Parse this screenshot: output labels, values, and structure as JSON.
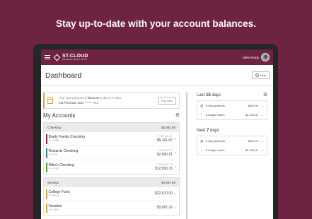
{
  "headline": "Stay up-to-date with your account balances.",
  "brand": {
    "name": "ST.CLOUD",
    "sub": "FINANCIAL CREDIT UNION"
  },
  "user": {
    "name": "Mike Brady"
  },
  "page": {
    "title": "Dashboard",
    "help_label": "Help"
  },
  "notice": {
    "line1_prefix": "Your loan payment of",
    "amount": "$521.84",
    "line1_suffix": "is due in 3 days",
    "account": "Kia Purchase 2017",
    "masked": "*******913",
    "pay_label": "Pay Now"
  },
  "accounts": {
    "title": "My Accounts",
    "checking": {
      "label": "Checking",
      "total": "$4,982.59",
      "items": [
        {
          "name": "Brady Family Checking",
          "num": "*****4258",
          "available": "$5,161.87",
          "current": "$5,161.87",
          "color": "#7a2a4a"
        },
        {
          "name": "Rewards Checking",
          "num": "*****478",
          "available": "$2,690.21",
          "current": "$2,690.21",
          "color": "#2f8b8b"
        },
        {
          "name": "Mike's Checking",
          "num": "*****1746",
          "available": "$12,893.76",
          "current": "$12,893.76",
          "color": "#5a9a3a"
        }
      ]
    },
    "savings": {
      "label": "Savings",
      "total": "$4,982.59",
      "items": [
        {
          "name": "College Fund",
          "num": "*****8003",
          "current": "$32,670.00",
          "color": "#d9a93b"
        },
        {
          "name": "Vacation",
          "num": "*****1928",
          "current": "$3,087.22",
          "color": "#d9a93b"
        }
      ]
    }
  },
  "last": {
    "title_prefix": "Last",
    "days": "15",
    "title_suffix": "days",
    "rows": [
      {
        "count": "2",
        "label": "bill payments",
        "amount": "$604.99"
      },
      {
        "count": "2",
        "label": "budget alerts",
        "amount": "$2,130.00"
      }
    ]
  },
  "next": {
    "title_prefix": "Next",
    "days": "7",
    "title_suffix": "days",
    "rows": [
      {
        "count": "2",
        "label": "bill payments",
        "amount": "$604.99"
      },
      {
        "count": "2",
        "label": "budget alerts",
        "amount": "$2,130.00"
      }
    ]
  },
  "colors": {
    "brand": "#6e2343",
    "accent": "#d9a93b"
  }
}
